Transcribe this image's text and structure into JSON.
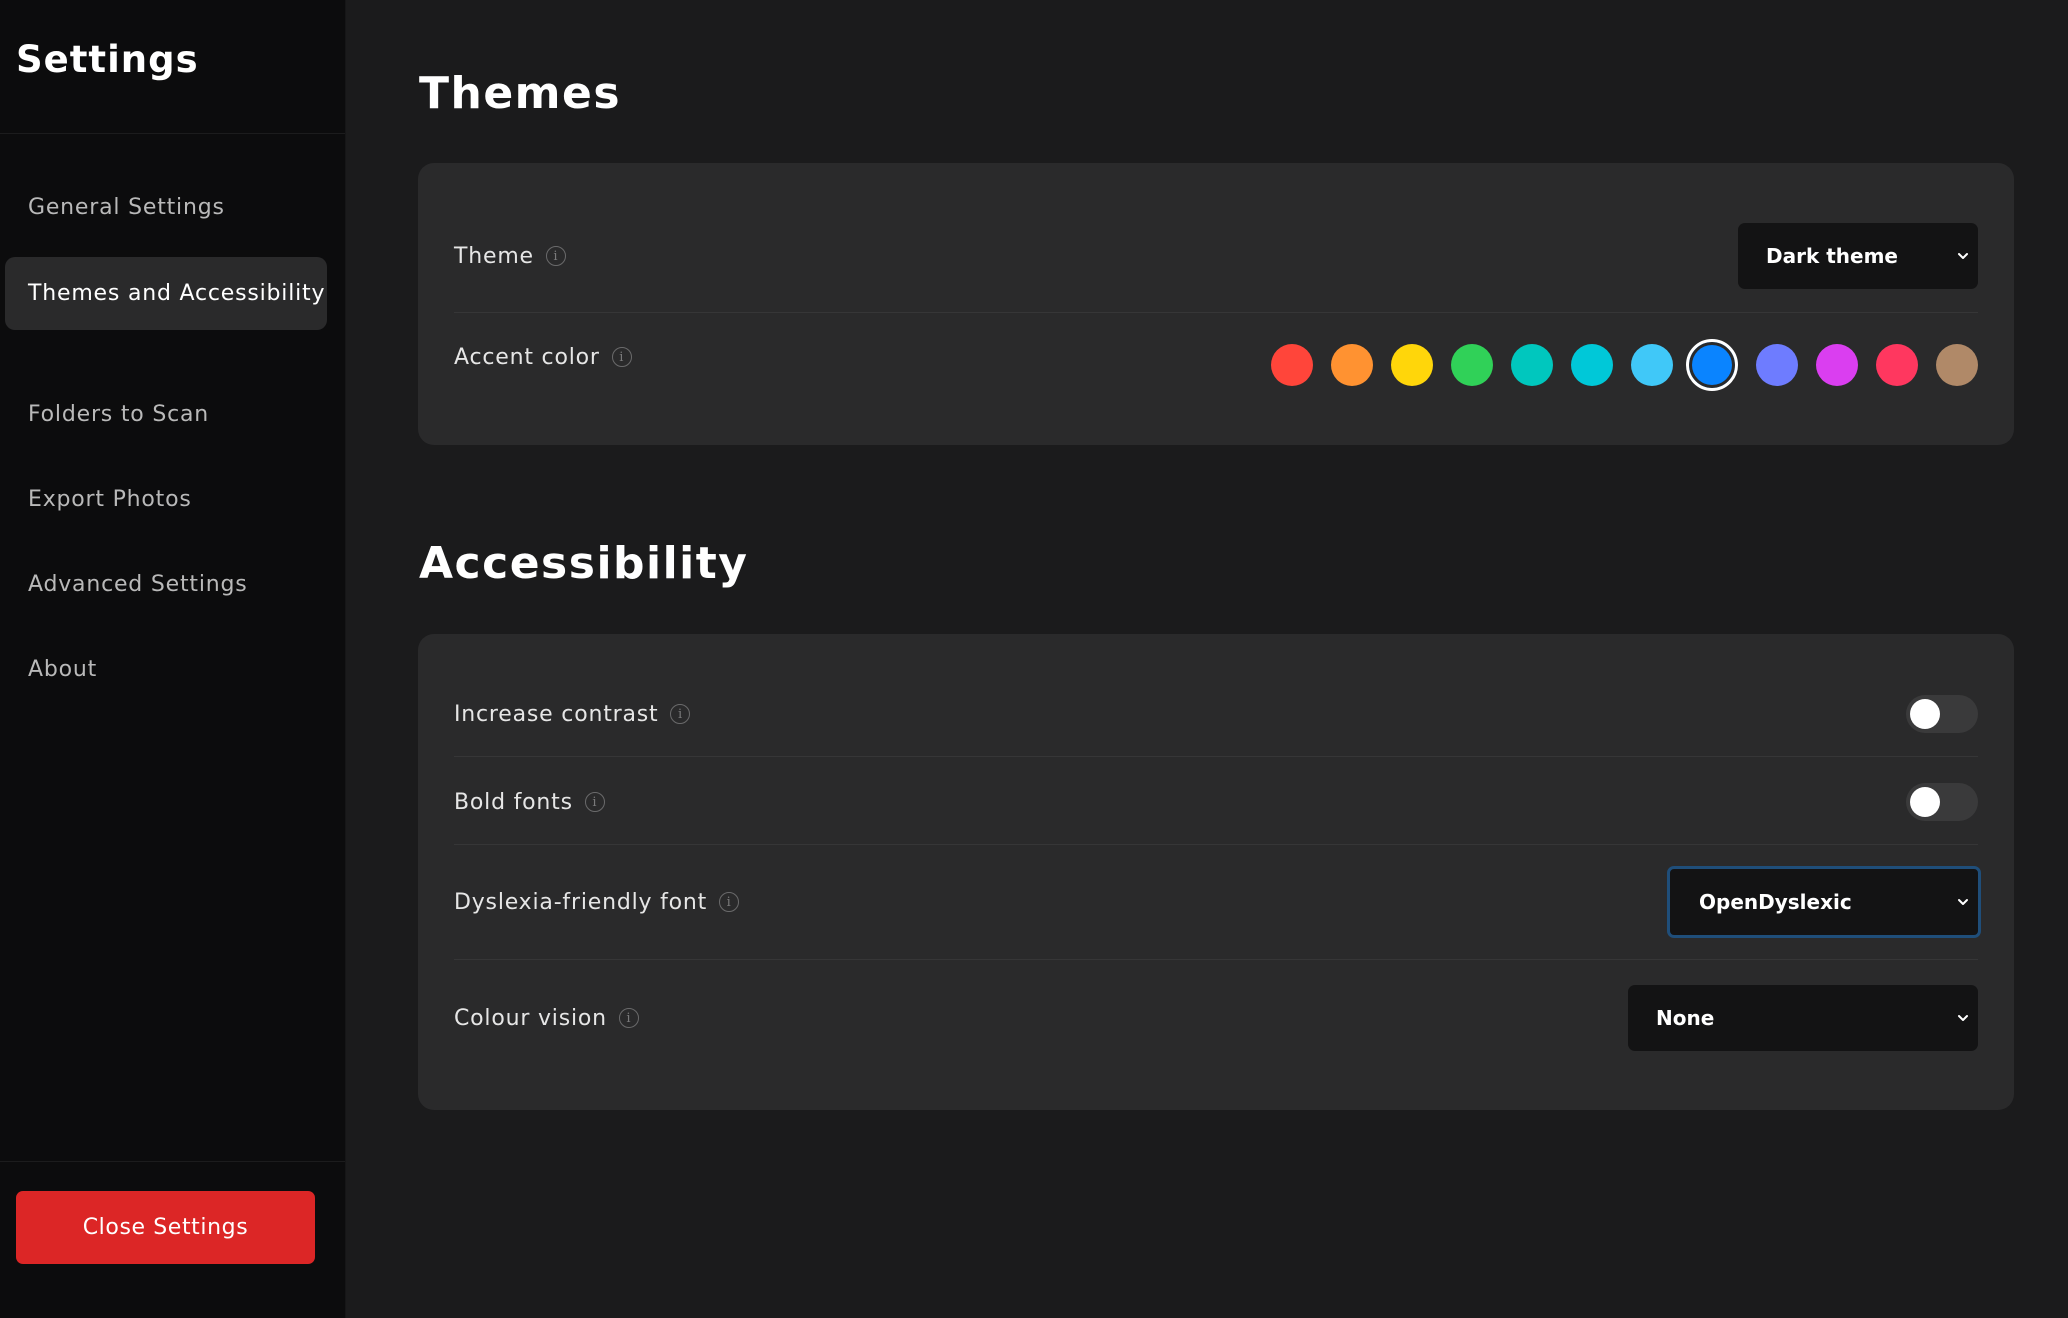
{
  "sidebar": {
    "title": "Settings",
    "items": [
      {
        "label": "General Settings"
      },
      {
        "label": "Themes and Accessibility"
      },
      {
        "label": "Folders to Scan"
      },
      {
        "label": "Export Photos"
      },
      {
        "label": "Advanced Settings"
      },
      {
        "label": "About"
      }
    ],
    "active_item": "Themes and Accessibility",
    "close_label": "Close Settings"
  },
  "themes": {
    "title": "Themes",
    "theme_label": "Theme",
    "theme_value": "Dark theme",
    "accent_label": "Accent color",
    "accent_colors": [
      "#ff453a",
      "#ff9231",
      "#ffd60a",
      "#30d158",
      "#00c7be",
      "#00c8d8",
      "#40c8f8",
      "#0a84ff",
      "#6e7cff",
      "#da3ef0",
      "#ff375f",
      "#b08968"
    ],
    "accent_selected": "#0a84ff"
  },
  "accessibility": {
    "title": "Accessibility",
    "increase_contrast_label": "Increase contrast",
    "increase_contrast_on": false,
    "bold_fonts_label": "Bold fonts",
    "bold_fonts_on": false,
    "dyslexia_label": "Dyslexia-friendly font",
    "dyslexia_value": "OpenDyslexic",
    "colour_vision_label": "Colour vision",
    "colour_vision_value": "None"
  },
  "icons": {
    "info": "info-icon",
    "chevron": "chevron-down-icon"
  },
  "colors": {
    "sidebar_bg": "#0c0c0d",
    "main_bg": "#1b1b1c",
    "card_bg": "#2a2a2b",
    "close_button": "#dc2626",
    "focus_ring": "#1f4e7a"
  }
}
